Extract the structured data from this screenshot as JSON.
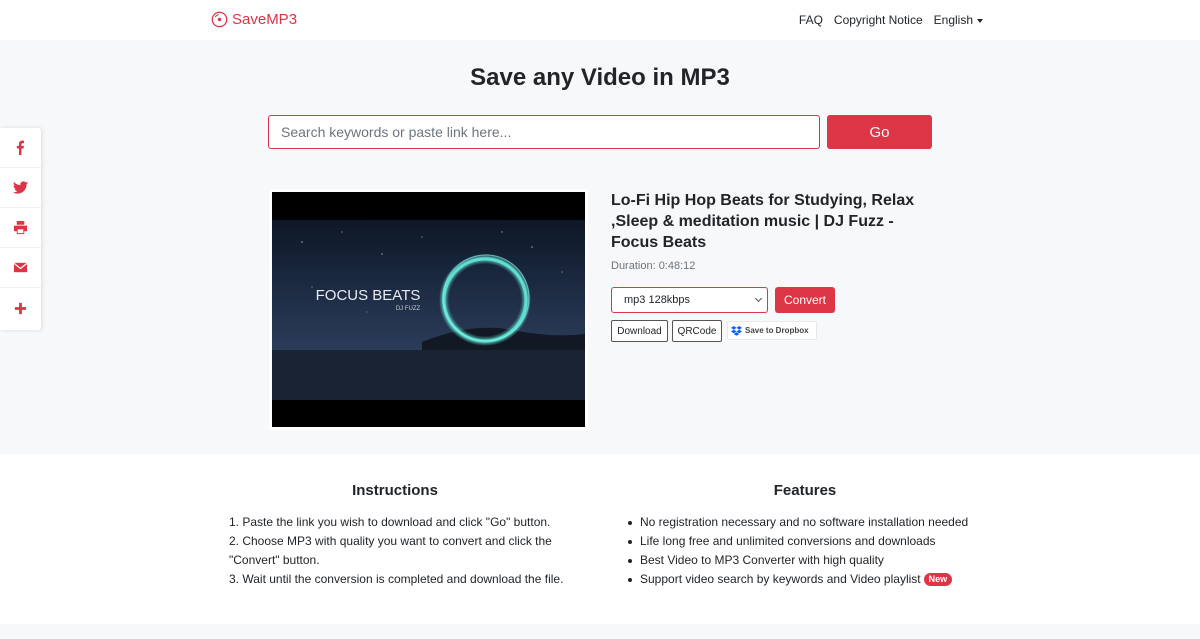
{
  "header": {
    "brand": "SaveMP3",
    "nav": {
      "faq": "FAQ",
      "copyright": "Copyright Notice",
      "language": "English"
    }
  },
  "hero": {
    "title": "Save any Video in MP3",
    "search_placeholder": "Search keywords or paste link here...",
    "go_label": "Go"
  },
  "result": {
    "title": "Lo-Fi Hip Hop Beats for Studying, Relax ,Sleep & meditation music | DJ Fuzz - Focus Beats",
    "duration": "Duration: 0:48:12",
    "thumbnail_text": "FOCUS BEATS",
    "thumbnail_subtext": "DJ FUZZ",
    "quality": "mp3 128kbps",
    "convert_label": "Convert",
    "download_label": "Download",
    "qrcode_label": "QRCode",
    "dropbox_label": "Save to Dropbox"
  },
  "share": {
    "items": [
      "facebook-icon",
      "twitter-icon",
      "print-icon",
      "email-icon",
      "plus-icon"
    ]
  },
  "instructions": {
    "title": "Instructions",
    "steps": [
      "1. Paste the link you wish to download and click \"Go\" button.",
      "2. Choose MP3 with quality you want to convert and click the",
      "\"Convert\" button.",
      "3. Wait until the conversion is completed and download the file."
    ]
  },
  "features": {
    "title": "Features",
    "items": [
      "No registration necessary and no software installation needed",
      "Life long free and unlimited conversions and downloads",
      "Best Video to MP3 Converter with high quality",
      "Support video search by keywords and Video playlist"
    ],
    "new_badge": "New"
  },
  "colors": {
    "accent": "#dc3545",
    "hero_bg": "#f7f8fa",
    "orb": "#4fd8c8"
  }
}
